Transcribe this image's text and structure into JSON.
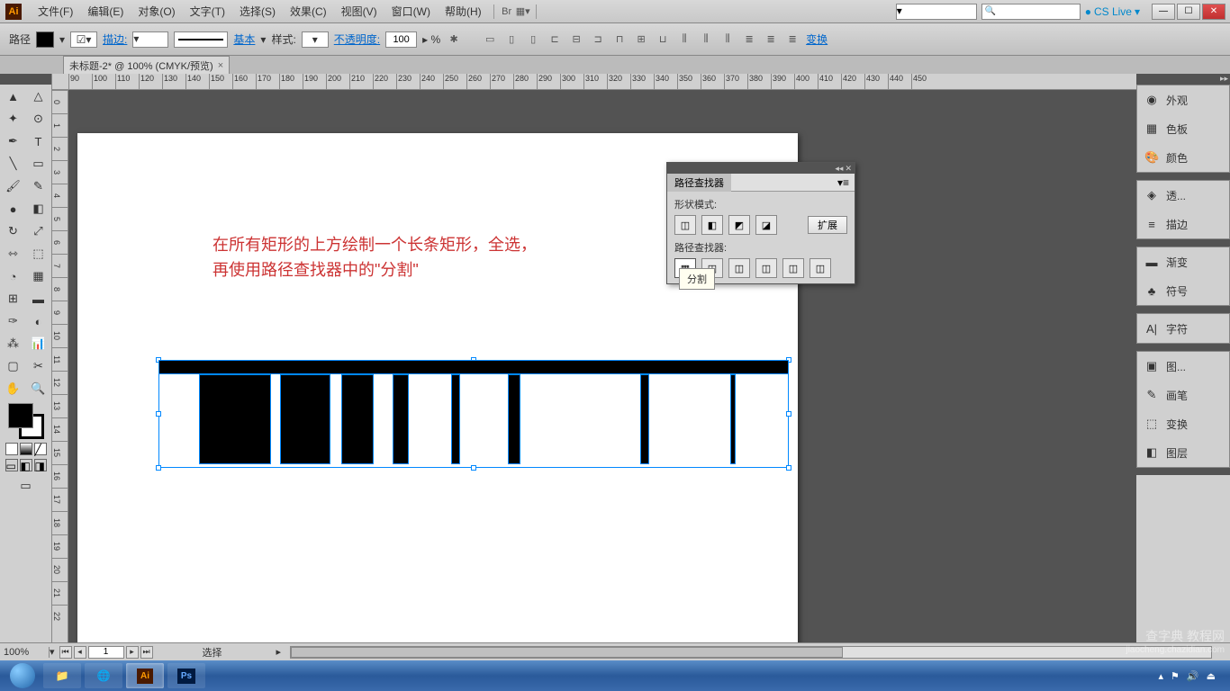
{
  "app_logo": "Ai",
  "menu": [
    "文件(F)",
    "编辑(E)",
    "对象(O)",
    "文字(T)",
    "选择(S)",
    "效果(C)",
    "视图(V)",
    "窗口(W)",
    "帮助(H)"
  ],
  "cslive": "CS Live",
  "control": {
    "label": "路径",
    "stroke_label": "描边:",
    "basic_label": "基本",
    "style_label": "样式:",
    "opacity_label": "不透明度:",
    "opacity_value": "100",
    "opacity_unit": "▸ %",
    "transform_label": "变换"
  },
  "doctab": {
    "title": "未标题-2* @ 100% (CMYK/预览)",
    "close": "×"
  },
  "ruler_h": [
    "90",
    "100",
    "110",
    "120",
    "130",
    "140",
    "150",
    "160",
    "170",
    "180",
    "190",
    "200",
    "210",
    "220",
    "230",
    "240",
    "250",
    "260",
    "270",
    "280",
    "290",
    "300",
    "310",
    "320",
    "330",
    "340",
    "350",
    "360",
    "370",
    "380",
    "390",
    "400",
    "410",
    "420",
    "430",
    "440",
    "450"
  ],
  "ruler_v": [
    "0",
    "1",
    "2",
    "3",
    "4",
    "5",
    "6",
    "7",
    "8",
    "9",
    "10",
    "11",
    "12",
    "13",
    "14",
    "15",
    "16",
    "17",
    "18",
    "19",
    "20",
    "21",
    "22"
  ],
  "annotation": {
    "line1": "在所有矩形的上方绘制一个长条矩形，全选，",
    "line2": "再使用路径查找器中的\"分割\""
  },
  "pathfinder": {
    "title": "路径查找器",
    "shape_modes": "形状模式:",
    "pathfinders": "路径查找器:",
    "expand": "扩展"
  },
  "tooltip": "分割",
  "right_panels": [
    [
      {
        "icon": "◉",
        "label": "外观"
      },
      {
        "icon": "▦",
        "label": "色板"
      },
      {
        "icon": "🎨",
        "label": "颜色"
      }
    ],
    [
      {
        "icon": "◈",
        "label": "透..."
      },
      {
        "icon": "≡",
        "label": "描边"
      }
    ],
    [
      {
        "icon": "▬",
        "label": "渐变"
      },
      {
        "icon": "♣",
        "label": "符号"
      }
    ],
    [
      {
        "icon": "A|",
        "label": "字符"
      }
    ],
    [
      {
        "icon": "▣",
        "label": "图..."
      },
      {
        "icon": "✎",
        "label": "画笔"
      },
      {
        "icon": "⬚",
        "label": "变换"
      },
      {
        "icon": "◧",
        "label": "图层"
      }
    ]
  ],
  "status": {
    "zoom": "100%",
    "page": "1",
    "select": "选择"
  },
  "watermark": {
    "main": "查字典 教程网",
    "sub": "jiaocheng.chazidian.com"
  }
}
